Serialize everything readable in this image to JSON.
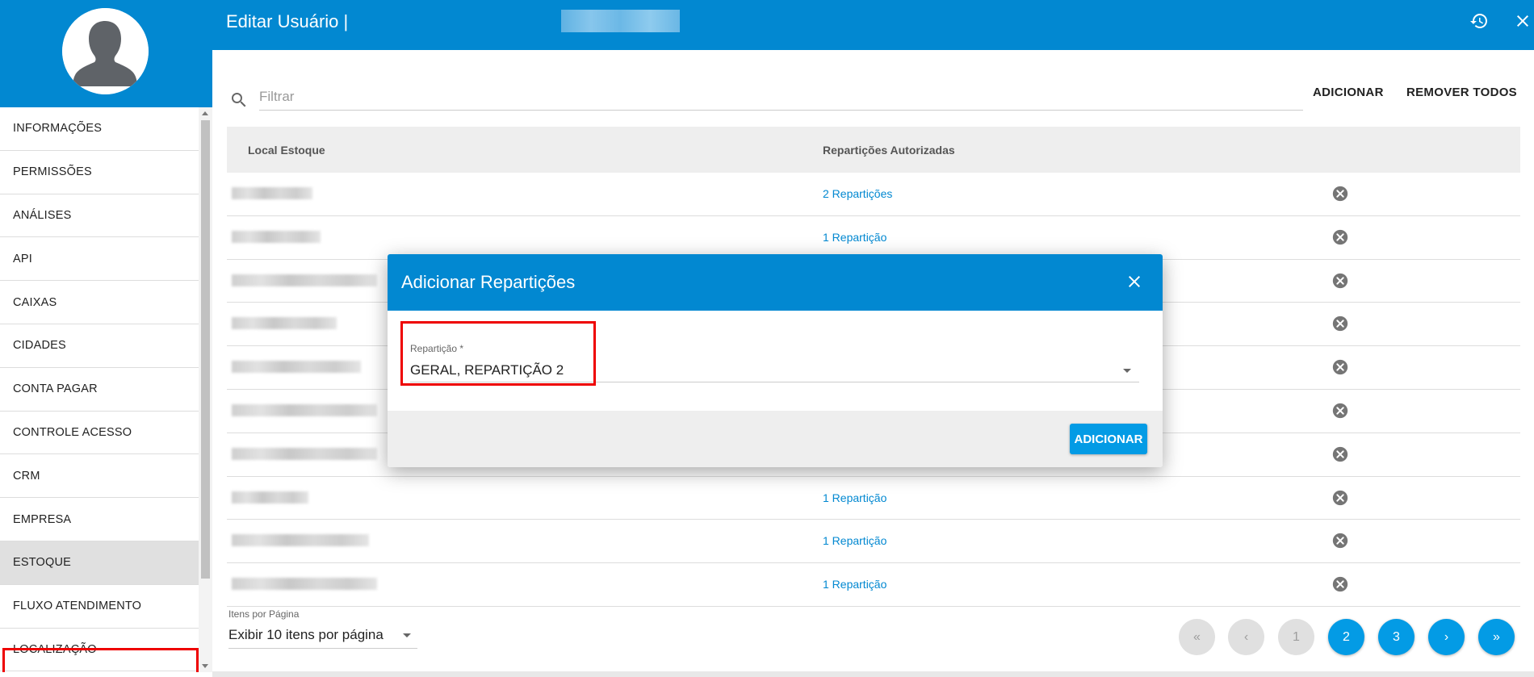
{
  "header": {
    "title": "Editar Usuário |",
    "history_icon": "history-icon",
    "close_icon": "close-icon"
  },
  "sidebar": {
    "avatar_icon": "user-avatar-icon",
    "items": [
      {
        "label": "INFORMAÇÕES"
      },
      {
        "label": "PERMISSÕES"
      },
      {
        "label": "ANÁLISES"
      },
      {
        "label": "API"
      },
      {
        "label": "CAIXAS"
      },
      {
        "label": "CIDADES"
      },
      {
        "label": "CONTA PAGAR"
      },
      {
        "label": "CONTROLE ACESSO"
      },
      {
        "label": "CRM"
      },
      {
        "label": "EMPRESA"
      },
      {
        "label": "ESTOQUE"
      },
      {
        "label": "FLUXO ATENDIMENTO"
      },
      {
        "label": "LOCALIZAÇÃO"
      }
    ],
    "active_item": "ESTOQUE"
  },
  "toolbar": {
    "filter_placeholder": "Filtrar",
    "add_label": "ADICIONAR",
    "remove_all_label": "REMOVER TODOS"
  },
  "table": {
    "columns": [
      "Local Estoque",
      "Repartições Autorizadas"
    ],
    "rows": [
      {
        "reparticoes": "2 Repartições"
      },
      {
        "reparticoes": "1 Repartição"
      },
      {
        "reparticoes": ""
      },
      {
        "reparticoes": ""
      },
      {
        "reparticoes": ""
      },
      {
        "reparticoes": ""
      },
      {
        "reparticoes": ""
      },
      {
        "reparticoes": "1 Repartição"
      },
      {
        "reparticoes": "1 Repartição"
      },
      {
        "reparticoes": "1 Repartição"
      }
    ]
  },
  "pagination": {
    "items_label": "Itens por Página",
    "items_value": "Exibir 10 itens por página",
    "first": "«",
    "prev": "‹",
    "pages": [
      "1",
      "2",
      "3"
    ],
    "current_page": "1",
    "next": "›",
    "last": "»"
  },
  "dialog": {
    "title": "Adicionar Repartições",
    "field_label": "Repartição *",
    "field_value": "GERAL, REPARTIÇÃO 2",
    "submit_label": "ADICIONAR"
  }
}
